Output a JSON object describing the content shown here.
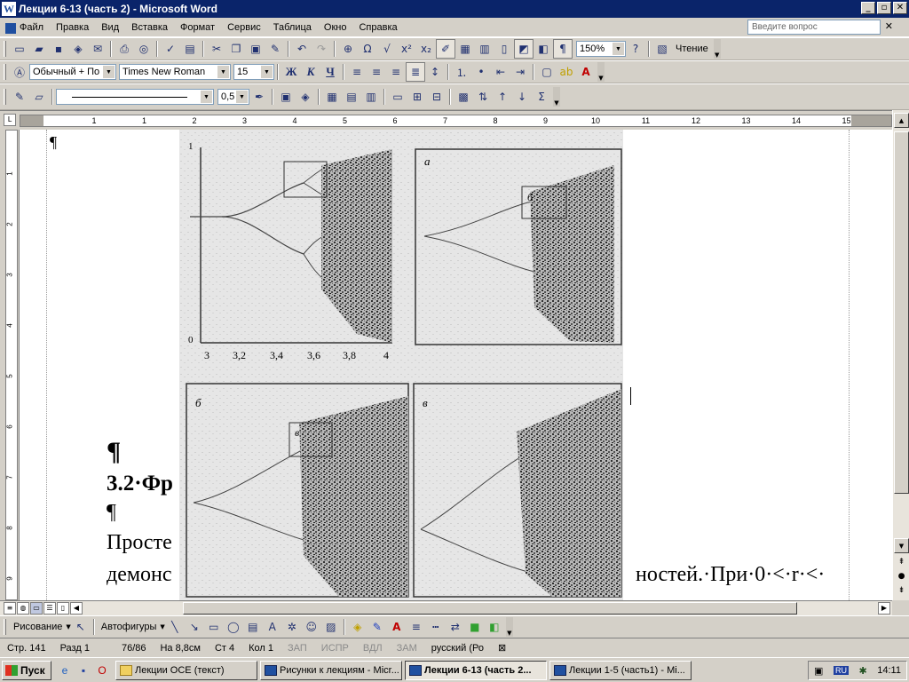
{
  "window": {
    "title": "Лекции  6-13 (часть 2) - Microsoft Word",
    "app_icon": "W",
    "buttons": [
      "_",
      "▫",
      "✕"
    ]
  },
  "menu": {
    "items": [
      "Файл",
      "Правка",
      "Вид",
      "Вставка",
      "Формат",
      "Сервис",
      "Таблица",
      "Окно",
      "Справка"
    ],
    "ask_placeholder": "Введите вопрос",
    "close": "✕"
  },
  "standard_toolbar": {
    "zoom": "150%",
    "read_label": "Чтение"
  },
  "format_toolbar": {
    "style": "Обычный + По ц",
    "font": "Times New Roman",
    "size": "15",
    "bold": "Ж",
    "italic": "К",
    "underline": "Ч"
  },
  "tables_toolbar": {
    "line_weight": "0,5",
    "sum": "Σ"
  },
  "ruler": {
    "numbers": [
      "1",
      "1",
      "2",
      "3",
      "4",
      "5",
      "6",
      "7",
      "8",
      "9",
      "10",
      "11",
      "12",
      "13",
      "14",
      "15"
    ]
  },
  "vruler": {
    "numbers": [
      "1",
      "2",
      "3",
      "4",
      "5",
      "6",
      "7",
      "8",
      "9"
    ]
  },
  "document": {
    "para_mark_top": "¶",
    "para_mark_1": "¶",
    "heading": "3.2·Фр",
    "para_mark_2": "¶",
    "body_line_1": "Просте",
    "body_line_2_left": "демонс",
    "body_line_2_right": "ностей.·При·0·<·r·<·"
  },
  "figure": {
    "top_left": {
      "y_max": "1",
      "y_min": "0",
      "x_ticks": [
        "3",
        "3,2",
        "3,4",
        "3,6",
        "3,8",
        "4"
      ]
    },
    "top_right": {
      "label": "а",
      "box_label": "б"
    },
    "bottom_left": {
      "label": "б",
      "box_label": "в"
    },
    "bottom_right": {
      "label": "в"
    }
  },
  "drawing_toolbar": {
    "draw": "Рисование",
    "autoshapes": "Автофигуры"
  },
  "status": {
    "page": "Стр. 141",
    "section": "Разд 1",
    "pages": "76/86",
    "at": "На 8,8см",
    "line": "Ст 4",
    "col": "Кол 1",
    "modes": [
      "ЗАП",
      "ИСПР",
      "ВДЛ",
      "ЗАМ"
    ],
    "language": "русский (Ро"
  },
  "taskbar": {
    "start": "Пуск",
    "tasks": [
      {
        "label": "Лекции ОСЕ (текст)",
        "active": false
      },
      {
        "label": "Рисунки к лекциям - Micr...",
        "active": false
      },
      {
        "label": "Лекции  6-13 (часть 2...",
        "active": true
      },
      {
        "label": "Лекции 1-5 (часть1) - Mi...",
        "active": false
      }
    ],
    "lang": "RU",
    "time": "14:11"
  }
}
